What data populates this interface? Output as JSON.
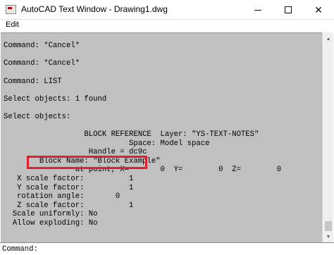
{
  "window": {
    "title": "AutoCAD Text Window - Drawing1.dwg",
    "icon": "autocad-app-icon",
    "minimize_glyph": "—",
    "maximize_glyph": "☐",
    "close_glyph": "✕"
  },
  "menu": {
    "edit": "Edit"
  },
  "history": [
    "Command: *Cancel*",
    "Command: *Cancel*",
    "Command: LIST",
    "Select objects: 1 found",
    "Select objects:",
    "                  BLOCK REFERENCE  Layer: \"YS-TEXT-NOTES\"",
    "                            Space: Model space",
    "                   Handle = dc9c",
    "        Block Name: \"Block Example\"",
    "                at point, X=       0  Y=        0  Z=        0",
    "   X scale factor:          1",
    "   Y scale factor:          1",
    "   rotation angle:       0",
    "   Z scale factor:          1",
    "  Scale uniformly: No",
    "  Allow exploding: No"
  ],
  "command_line": {
    "prompt": "Command:",
    "value": ""
  },
  "colors": {
    "highlight": "#e0202a",
    "text_background": "#c0c0c0"
  }
}
